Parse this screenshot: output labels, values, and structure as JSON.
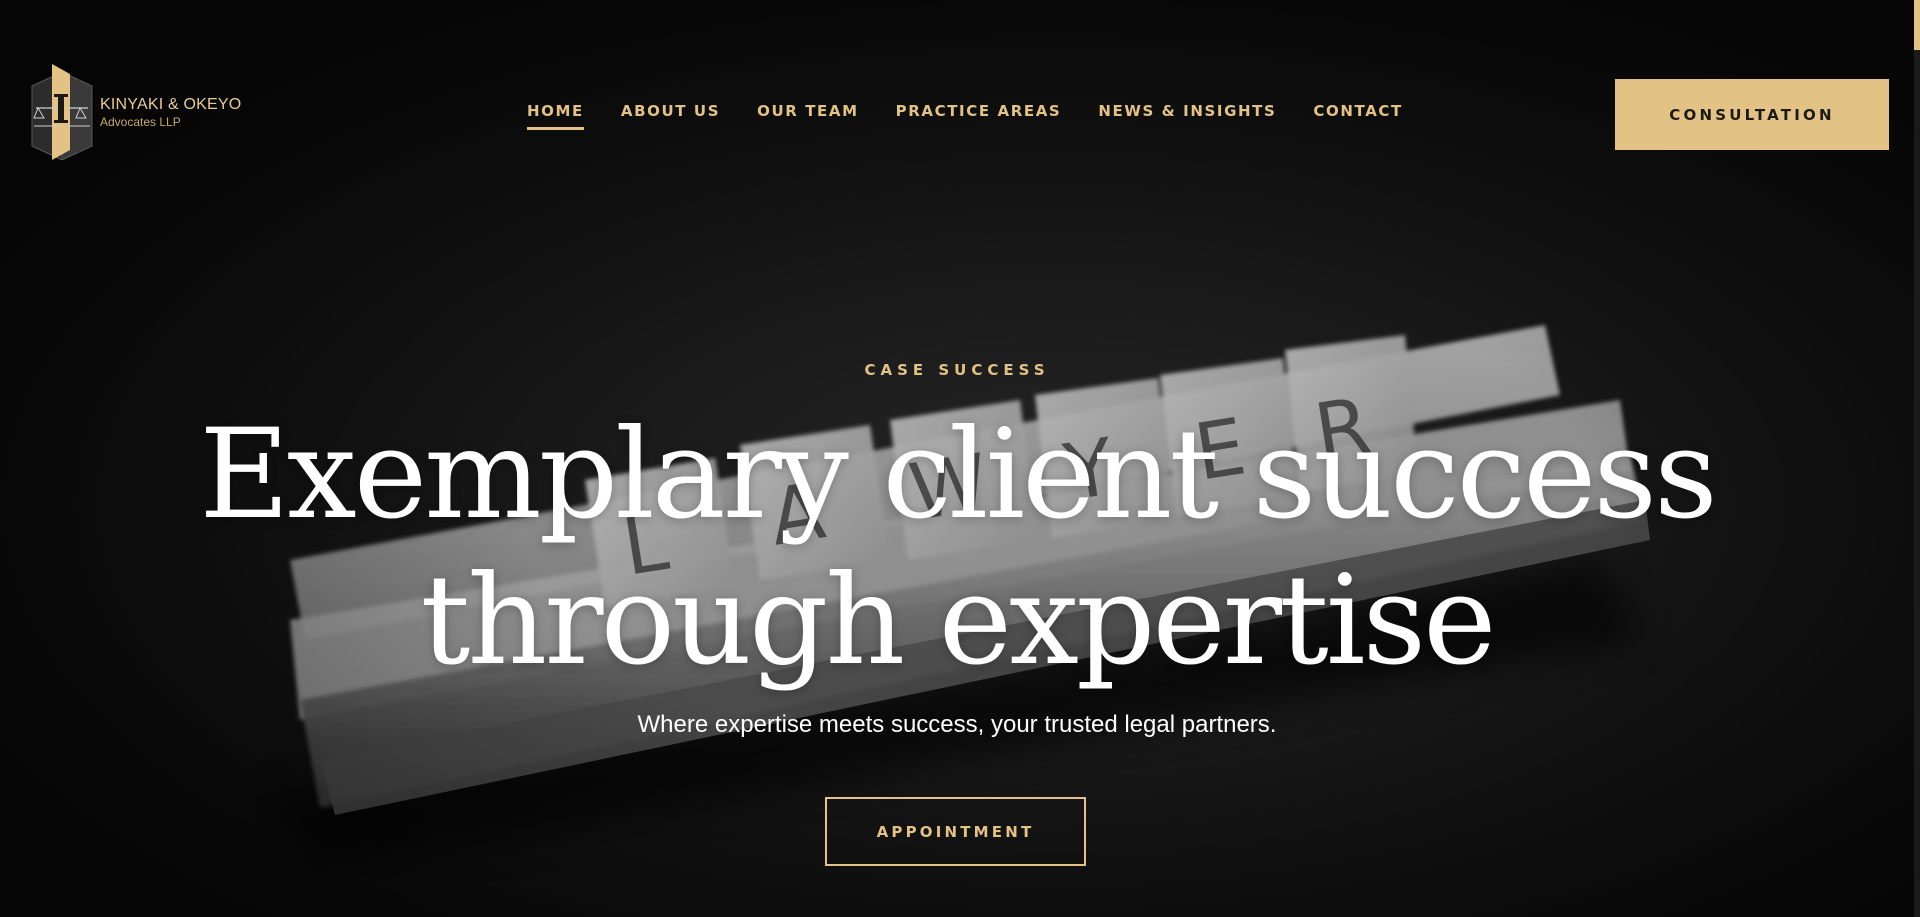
{
  "brand": {
    "name": "KINYAKI & OKEYO",
    "subtitle": "Advocates LLP",
    "accent_color": "#e3c285",
    "logo_icon": "scales-of-justice-icon"
  },
  "nav": {
    "items": [
      {
        "label": "HOME",
        "active": true
      },
      {
        "label": "ABOUT US",
        "active": false
      },
      {
        "label": "OUR TEAM",
        "active": false
      },
      {
        "label": "PRACTICE AREAS",
        "active": false
      },
      {
        "label": "NEWS & INSIGHTS",
        "active": false
      },
      {
        "label": "CONTACT",
        "active": false
      }
    ],
    "cta_label": "CONSULTATION"
  },
  "hero": {
    "eyebrow": "CASE SUCCESS",
    "headline_line1": "Exemplary client success",
    "headline_line2": "through expertise",
    "subline": "Where expertise meets success, your trusted legal partners.",
    "cta_label": "APPOINTMENT",
    "background_tiles": [
      "L",
      "A",
      "W",
      "Y",
      "E",
      "R"
    ]
  }
}
